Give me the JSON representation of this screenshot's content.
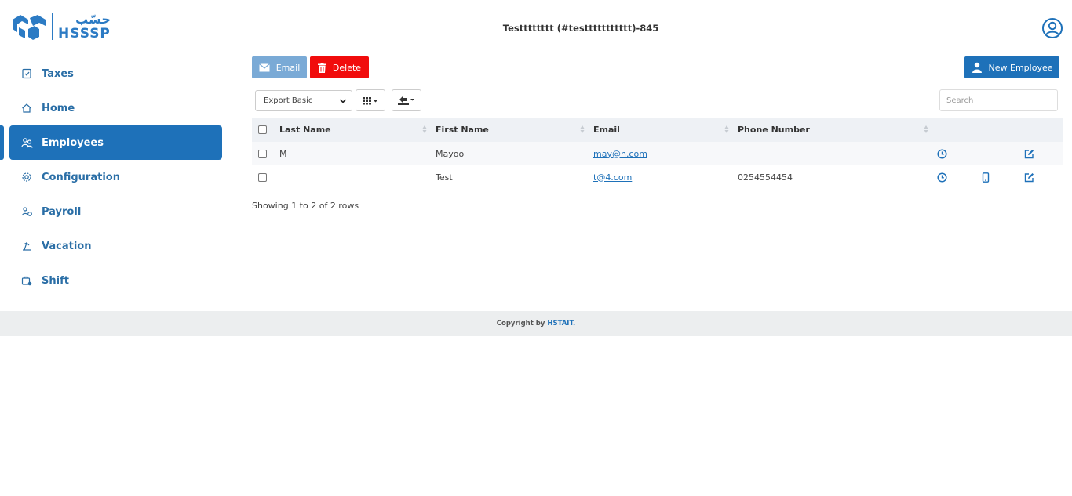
{
  "brand": {
    "arabic": "حسّب",
    "name": "HSSSP"
  },
  "header": {
    "title": "Testttttttt (#testtttttttttt)-845"
  },
  "colors": {
    "primary": "#1e71b9",
    "danger": "#f10c0c",
    "email_btn": "#7aaad6"
  },
  "sidebar": {
    "items": [
      {
        "label": "Taxes",
        "icon": "taxes-icon",
        "active": false
      },
      {
        "label": "Home",
        "icon": "home-icon",
        "active": false
      },
      {
        "label": "Employees",
        "icon": "employees-icon",
        "active": true
      },
      {
        "label": "Configuration",
        "icon": "gear-icon",
        "active": false
      },
      {
        "label": "Payroll",
        "icon": "payroll-icon",
        "active": false
      },
      {
        "label": "Vacation",
        "icon": "vacation-icon",
        "active": false
      },
      {
        "label": "Shift",
        "icon": "shift-icon",
        "active": false
      }
    ]
  },
  "toolbar": {
    "email_label": "Email",
    "delete_label": "Delete",
    "new_employee_label": "New Employee",
    "export_select": "Export Basic",
    "search_placeholder": "Search"
  },
  "table": {
    "columns": [
      "Last Name",
      "First Name",
      "Email",
      "Phone Number"
    ],
    "rows": [
      {
        "last_name": "M",
        "first_name": "Mayoo",
        "email": "may@h.com",
        "phone": "",
        "has_mobile": false
      },
      {
        "last_name": "",
        "first_name": "Test",
        "email": "t@4.com",
        "phone": "0254554454",
        "has_mobile": true
      }
    ]
  },
  "pagination": {
    "showing": "Showing 1 to 2 of 2 rows"
  },
  "footer": {
    "text": "Copyright by",
    "brand": "HSTAIT."
  }
}
